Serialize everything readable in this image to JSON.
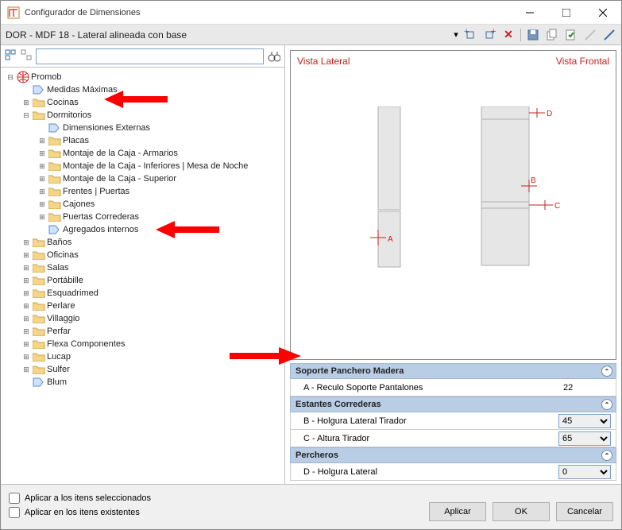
{
  "window": {
    "title": "Configurador de Dimensiones"
  },
  "context_bar": "DOR - MDF 18 - Lateral alineada con base",
  "search": {
    "placeholder": ""
  },
  "tree": {
    "root": {
      "label": "Promob"
    },
    "l1": [
      {
        "label": "Medidas Máximas",
        "exp": "",
        "icon": "tag"
      },
      {
        "label": "Cocinas",
        "exp": "+",
        "icon": "folder"
      },
      {
        "label": "Dormitorios",
        "exp": "-",
        "icon": "folder",
        "children": [
          {
            "label": "Dimensiones Externas",
            "icon": "tag"
          },
          {
            "label": "Placas",
            "exp": "+",
            "icon": "folder"
          },
          {
            "label": "Montaje de la Caja - Armarios",
            "exp": "+",
            "icon": "folder"
          },
          {
            "label": "Montaje de la Caja - Inferiores | Mesa de Noche",
            "exp": "+",
            "icon": "folder"
          },
          {
            "label": "Montaje de la Caja - Superior",
            "exp": "+",
            "icon": "folder"
          },
          {
            "label": "Frentes | Puertas",
            "exp": "+",
            "icon": "folder"
          },
          {
            "label": "Cajones",
            "exp": "+",
            "icon": "folder"
          },
          {
            "label": "Puertas Correderas",
            "exp": "+",
            "icon": "folder"
          },
          {
            "label": "Agregados internos",
            "icon": "tag"
          }
        ]
      },
      {
        "label": "Baños",
        "exp": "+",
        "icon": "folder"
      },
      {
        "label": "Oficinas",
        "exp": "+",
        "icon": "folder"
      },
      {
        "label": "Salas",
        "exp": "+",
        "icon": "folder"
      },
      {
        "label": "Portábille",
        "exp": "+",
        "icon": "folder"
      },
      {
        "label": "Esquadrimed",
        "exp": "+",
        "icon": "folder"
      },
      {
        "label": "Perlare",
        "exp": "+",
        "icon": "folder"
      },
      {
        "label": "Villaggio",
        "exp": "+",
        "icon": "folder"
      },
      {
        "label": "Perfar",
        "exp": "+",
        "icon": "folder"
      },
      {
        "label": "Flexa Componentes",
        "exp": "+",
        "icon": "folder"
      },
      {
        "label": "Lucap",
        "exp": "+",
        "icon": "folder"
      },
      {
        "label": "Sulfer",
        "exp": "+",
        "icon": "folder"
      },
      {
        "label": "Blum",
        "icon": "tag"
      }
    ]
  },
  "preview": {
    "left_label": "Vista Lateral",
    "right_label": "Vista Frontal",
    "dims": {
      "A": "A",
      "B": "B",
      "C": "C",
      "D": "D"
    }
  },
  "groups": [
    {
      "title": "Soporte Panchero Madera",
      "rows": [
        {
          "label": "A - Reculo Soporte Pantalones",
          "value": "22",
          "type": "text"
        }
      ]
    },
    {
      "title": "Estantes Correderas",
      "rows": [
        {
          "label": "B - Holgura Lateral Tirador",
          "value": "45",
          "type": "select"
        },
        {
          "label": "C - Altura Tirador",
          "value": "65",
          "type": "select"
        }
      ]
    },
    {
      "title": "Percheros",
      "rows": [
        {
          "label": "D - Holgura Lateral",
          "value": "0",
          "type": "select"
        }
      ]
    }
  ],
  "footer": {
    "chk1": "Aplicar a los itens seleccionados",
    "chk2": "Aplicar en los itens existentes",
    "apply": "Aplicar",
    "ok": "OK",
    "cancel": "Cancelar"
  }
}
